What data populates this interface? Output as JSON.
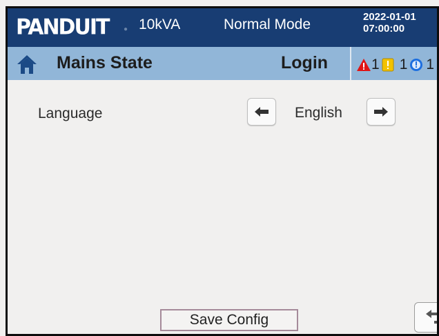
{
  "header": {
    "brand": "PANDUIT",
    "capacity": "10kVA",
    "mode": "Normal Mode",
    "date": "2022-01-01",
    "time": "07:00:00"
  },
  "subheader": {
    "title": "Mains State",
    "login": "Login",
    "alarms": [
      {
        "icon": "warning-triangle-icon",
        "count": "1",
        "color": "#e01515"
      },
      {
        "icon": "exclamation-box-icon",
        "count": "1",
        "color": "#f2c200"
      },
      {
        "icon": "info-circle-icon",
        "count": "1",
        "color": "#1d6fe0"
      }
    ]
  },
  "settings": {
    "language_label": "Language",
    "language_value": "English"
  },
  "footer": {
    "save_label": "Save Config"
  },
  "icons": {
    "home": "home-icon",
    "prev": "arrow-left-icon",
    "next": "arrow-right-icon",
    "back": "back-arrow-icon"
  }
}
